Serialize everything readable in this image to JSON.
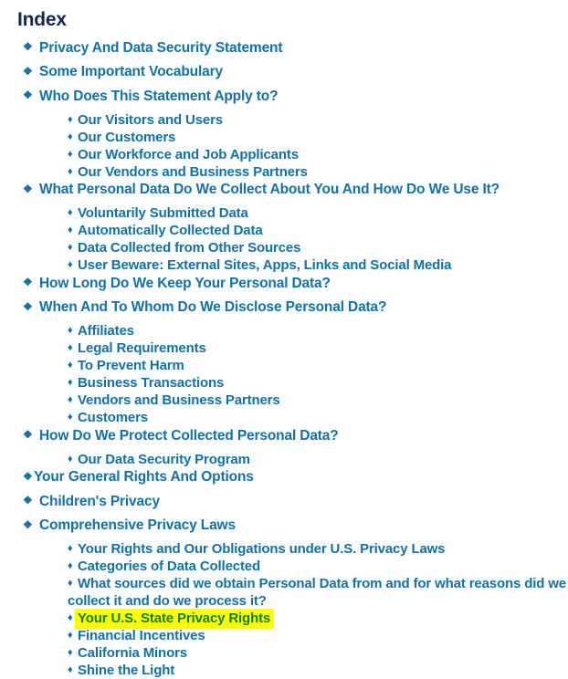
{
  "page": {
    "title": "Index",
    "title_color": "#14294b",
    "link_color": "#1371a4",
    "highlight_background": "#ffff00",
    "highlight_text_color": "#12801d",
    "background": "#ffffff"
  },
  "bullets": {
    "level1_glyph": "❖",
    "level1_icon_name": "diamond-minus-white-x-bullet-icon",
    "level2_glyph": "♦",
    "level2_icon_name": "black-diamond-bullet-icon"
  },
  "toc": [
    {
      "level": 1,
      "label": "Privacy And Data Security Statement",
      "highlighted": false,
      "tight": false
    },
    {
      "level": 1,
      "label": "Some Important Vocabulary",
      "highlighted": false,
      "tight": false
    },
    {
      "level": 1,
      "label": "Who Does This Statement Apply to?",
      "highlighted": false,
      "tight": false
    },
    {
      "level": 2,
      "label": "Our Visitors and Users",
      "highlighted": false
    },
    {
      "level": 2,
      "label": "Our Customers",
      "highlighted": false
    },
    {
      "level": 2,
      "label": "Our Workforce and Job Applicants",
      "highlighted": false
    },
    {
      "level": 2,
      "label": "Our Vendors and Business Partners",
      "highlighted": false
    },
    {
      "level": 1,
      "label": "What Personal Data Do We Collect About You And How Do We Use It?",
      "highlighted": false,
      "tight": false
    },
    {
      "level": 2,
      "label": "Voluntarily Submitted Data",
      "highlighted": false
    },
    {
      "level": 2,
      "label": "Automatically Collected Data",
      "highlighted": false
    },
    {
      "level": 2,
      "label": "Data Collected from Other Sources",
      "highlighted": false
    },
    {
      "level": 2,
      "label": "User Beware: External Sites, Apps, Links and Social Media",
      "highlighted": false
    },
    {
      "level": 1,
      "label": "How Long Do We Keep Your Personal Data?",
      "highlighted": false,
      "tight": false
    },
    {
      "level": 1,
      "label": "When And To Whom Do We Disclose Personal Data?",
      "highlighted": false,
      "tight": false
    },
    {
      "level": 2,
      "label": "Affiliates",
      "highlighted": false
    },
    {
      "level": 2,
      "label": "Legal Requirements",
      "highlighted": false
    },
    {
      "level": 2,
      "label": "To Prevent Harm",
      "highlighted": false
    },
    {
      "level": 2,
      "label": "Business Transactions",
      "highlighted": false
    },
    {
      "level": 2,
      "label": "Vendors and Business Partners",
      "highlighted": false
    },
    {
      "level": 2,
      "label": "Customers",
      "highlighted": false
    },
    {
      "level": 1,
      "label": "How Do We Protect Collected Personal Data?",
      "highlighted": false,
      "tight": false
    },
    {
      "level": 2,
      "label": "Our Data Security Program",
      "highlighted": false
    },
    {
      "level": 1,
      "label": "Your General Rights And Options",
      "highlighted": false,
      "tight": true
    },
    {
      "level": 1,
      "label": "Children's Privacy",
      "highlighted": false,
      "tight": false
    },
    {
      "level": 1,
      "label": "Comprehensive Privacy Laws",
      "highlighted": false,
      "tight": false
    },
    {
      "level": 2,
      "label": "Your Rights and Our Obligations under U.S. Privacy Laws",
      "highlighted": false
    },
    {
      "level": 2,
      "label": "Categories of Data Collected",
      "highlighted": false
    },
    {
      "level": 2,
      "label": "What sources did we obtain Personal Data from and for what reasons did we collect it and do we process it?",
      "highlighted": false
    },
    {
      "level": 2,
      "label": "Your U.S. State Privacy Rights",
      "highlighted": true
    },
    {
      "level": 2,
      "label": "Financial Incentives",
      "highlighted": false
    },
    {
      "level": 2,
      "label": "California Minors",
      "highlighted": false
    },
    {
      "level": 2,
      "label": "Shine the Light",
      "highlighted": false
    }
  ]
}
